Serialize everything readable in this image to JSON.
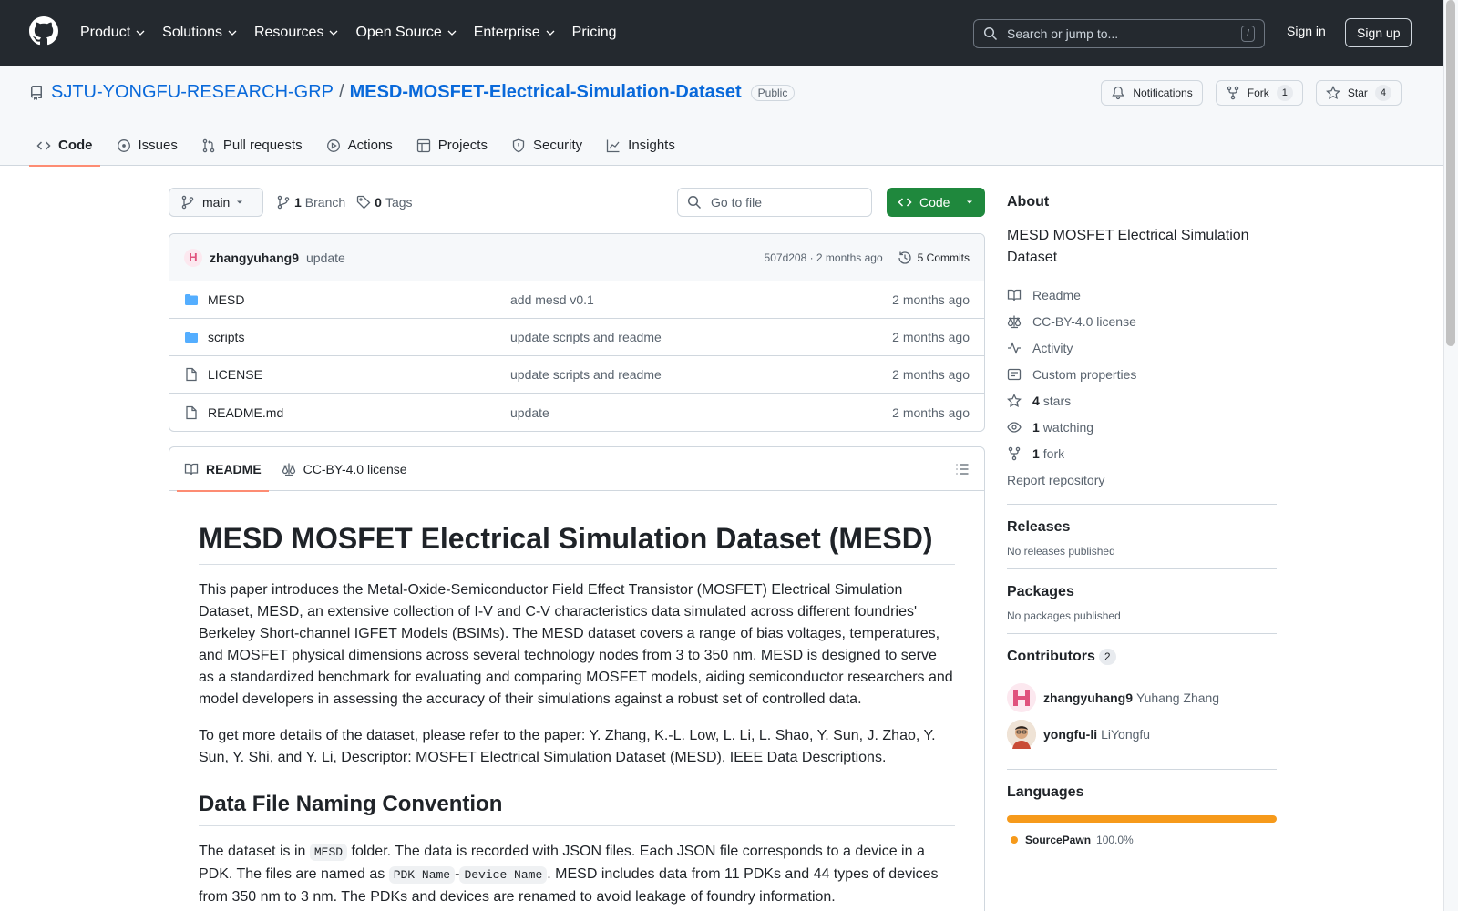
{
  "colors": {
    "header_bg": "#24292f",
    "accent_link": "#0969da",
    "code_button": "#1f883d",
    "tab_underline": "#fd8c73",
    "folder": "#54aeff",
    "sourcepawn": "#f69a1b"
  },
  "header": {
    "nav": [
      "Product",
      "Solutions",
      "Resources",
      "Open Source",
      "Enterprise",
      "Pricing"
    ],
    "search_placeholder": "Search or jump to...",
    "search_shortcut": "/",
    "signin": "Sign in",
    "signup": "Sign up"
  },
  "repo": {
    "owner": "SJTU-YONGFU-RESEARCH-GRP",
    "separator": "/",
    "name": "MESD-MOSFET-Electrical-Simulation-Dataset",
    "visibility": "Public",
    "notifications_label": "Notifications",
    "fork_label": "Fork",
    "fork_count": "1",
    "star_label": "Star",
    "star_count": "4",
    "tabs": [
      "Code",
      "Issues",
      "Pull requests",
      "Actions",
      "Projects",
      "Security",
      "Insights"
    ]
  },
  "filebar": {
    "branch": "main",
    "branch_count": "1",
    "branch_label": "Branch",
    "tag_count": "0",
    "tag_label": "Tags",
    "goto_placeholder": "Go to file",
    "code_label": "Code"
  },
  "commit": {
    "author": "zhangyuhang9",
    "message": "update",
    "hash_time": "507d208 · 2 months ago",
    "commits_label": "5 Commits"
  },
  "files": [
    {
      "type": "folder",
      "name": "MESD",
      "message": "add mesd v0.1",
      "date": "2 months ago"
    },
    {
      "type": "folder",
      "name": "scripts",
      "message": "update scripts and readme",
      "date": "2 months ago"
    },
    {
      "type": "file",
      "name": "LICENSE",
      "message": "update scripts and readme",
      "date": "2 months ago"
    },
    {
      "type": "file",
      "name": "README.md",
      "message": "update",
      "date": "2 months ago"
    }
  ],
  "readme": {
    "tab_readme": "README",
    "tab_license": "CC-BY-4.0 license",
    "h1": "MESD MOSFET Electrical Simulation Dataset (MESD)",
    "p1": "This paper introduces the Metal-Oxide-Semiconductor Field Effect Transistor (MOSFET) Electrical Simulation Dataset, MESD, an extensive collection of I-V and C-V characteristics data simulated across different foundries' Berkeley Short-channel IGFET Models (BSIMs). The MESD dataset covers a range of bias voltages, temperatures, and MOSFET physical dimensions across several technology nodes from 3 to 350 nm. MESD is designed to serve as a standardized benchmark for evaluating and comparing MOSFET models, aiding semiconductor researchers and model developers in assessing the accuracy of their simulations against a robust set of controlled data.",
    "p2": "To get more details of the dataset, please refer to the paper: Y. Zhang, K.-L. Low, L. Li, L. Shao, Y. Sun, J. Zhao, Y. Sun, Y. Shi, and Y. Li, Descriptor: MOSFET Electrical Simulation Dataset (MESD), IEEE Data Descriptions.",
    "h2": "Data File Naming Convention",
    "p3_a": "The dataset is in ",
    "p3_code1": "MESD",
    "p3_b": " folder. The data is recorded with JSON files. Each JSON file corresponds to a device in a PDK. The files are named as ",
    "p3_code2": "PDK Name",
    "p3_dash": "-",
    "p3_code3": "Device Name",
    "p3_c": ". MESD includes data from 11 PDKs and 44 types of devices from 350 nm to 3 nm. The PDKs and devices are renamed to avoid leakage of foundry information."
  },
  "about": {
    "title": "About",
    "description": "MESD MOSFET Electrical Simulation Dataset",
    "readme": "Readme",
    "license": "CC-BY-4.0 license",
    "activity": "Activity",
    "custom_properties": "Custom properties",
    "stars_count": "4",
    "stars_label": "stars",
    "watching_count": "1",
    "watching_label": "watching",
    "fork_count": "1",
    "fork_label": "fork",
    "report": "Report repository"
  },
  "releases": {
    "title": "Releases",
    "empty": "No releases published"
  },
  "packages": {
    "title": "Packages",
    "empty": "No packages published"
  },
  "contributors": {
    "title": "Contributors",
    "count": "2",
    "list": [
      {
        "login": "zhangyuhang9",
        "name": "Yuhang Zhang"
      },
      {
        "login": "yongfu-li",
        "name": "LiYongfu"
      }
    ]
  },
  "languages": {
    "title": "Languages",
    "list": [
      {
        "name": "SourcePawn",
        "percent": "100.0%",
        "share": 100
      }
    ]
  }
}
